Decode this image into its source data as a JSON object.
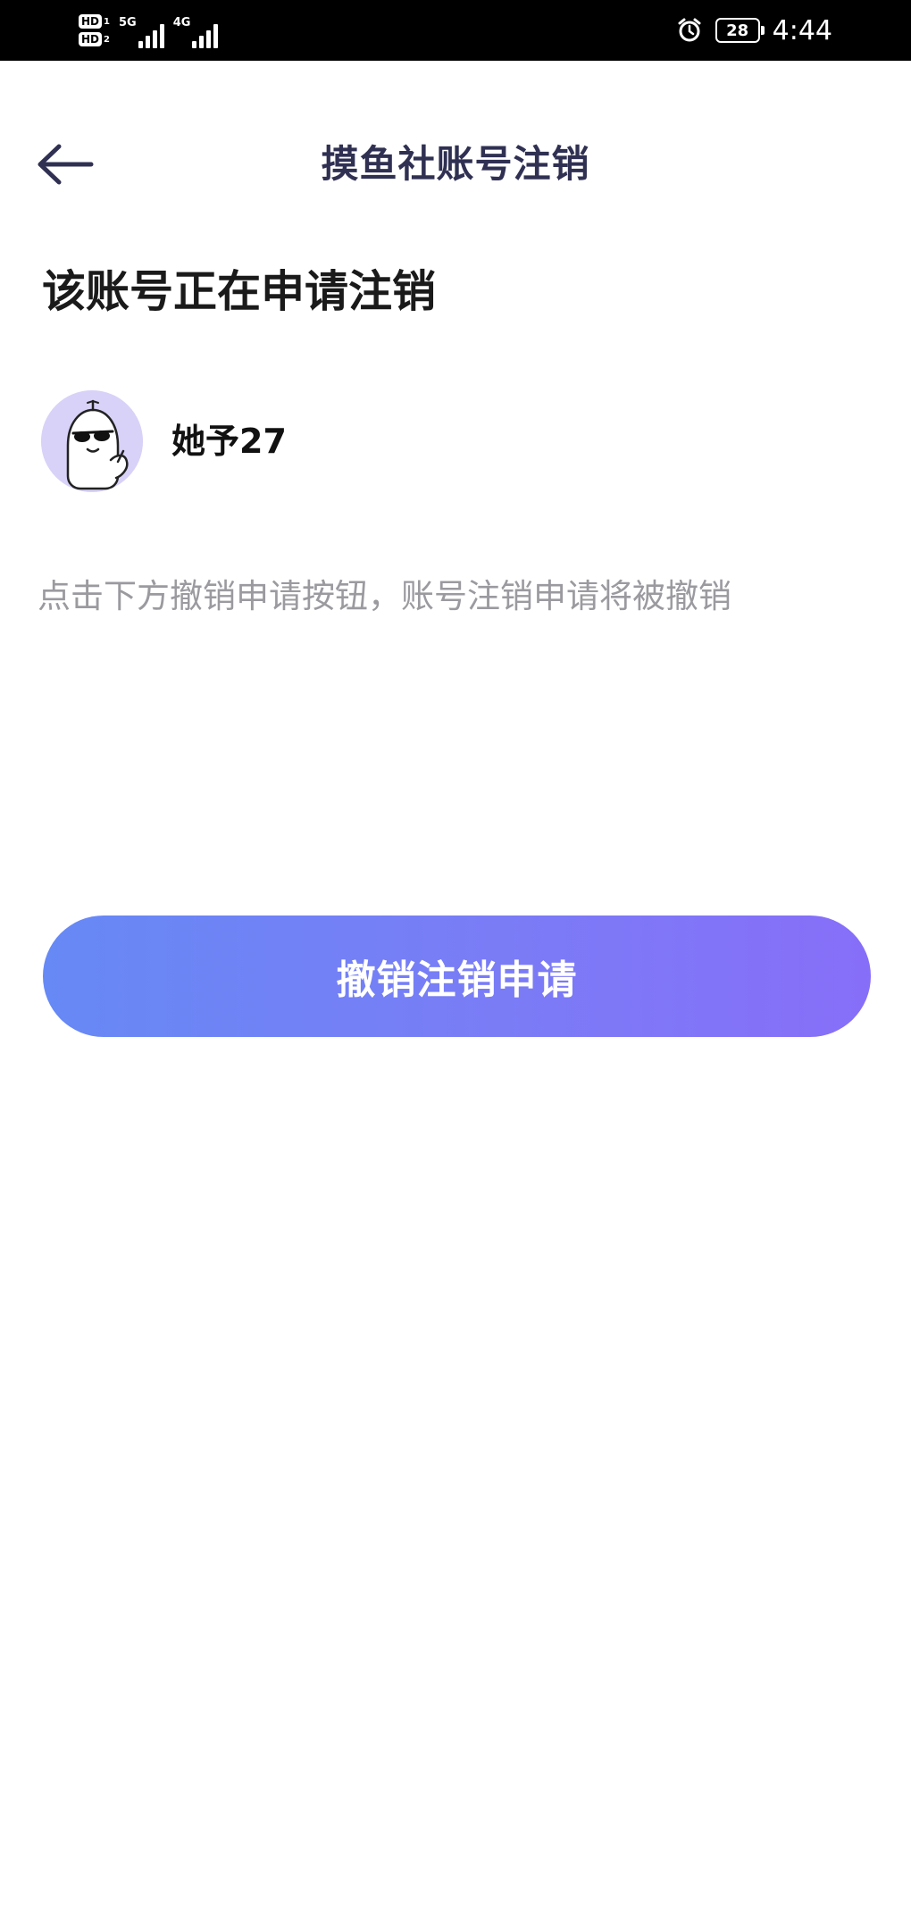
{
  "status_bar": {
    "hd1": "HD",
    "hd1_num": "1",
    "hd2": "HD",
    "hd2_num": "2",
    "network1": "5G",
    "network2": "4G",
    "battery": "28",
    "time": "4:44",
    "icons": [
      "alarm-icon",
      "battery-icon",
      "signal-icon"
    ]
  },
  "header": {
    "title": "摸鱼社账号注销",
    "back_icon": "arrow-left-icon"
  },
  "main": {
    "heading": "该账号正在申请注销",
    "user": {
      "name": "她予27",
      "avatar_icon": "cool-ghost-avatar"
    },
    "hint": "点击下方撤销申请按钮，账号注销申请将被撤销",
    "button_label": "撤销注销申请"
  },
  "colors": {
    "title": "#2f3052",
    "hint": "#9a9a9f",
    "button_gradient_start": "#6689f5",
    "button_gradient_end": "#876ef9",
    "avatar_bg": "#d8d2f8"
  }
}
